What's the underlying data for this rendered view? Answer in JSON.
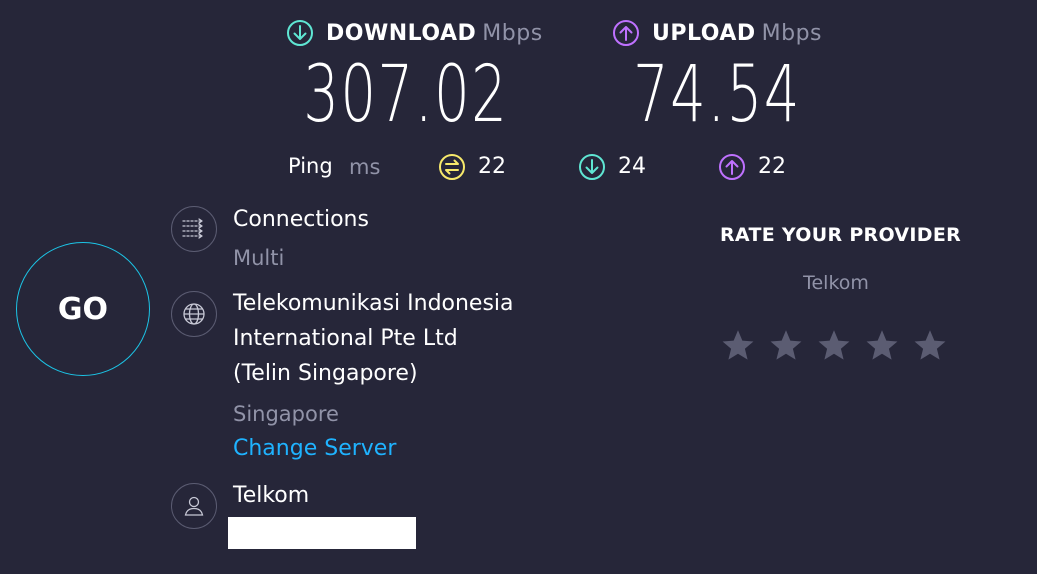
{
  "results": {
    "download": {
      "label": "DOWNLOAD",
      "unit": "Mbps",
      "value": "307.02",
      "icon": "download-arrow-icon",
      "color": "#5fe6d3"
    },
    "upload": {
      "label": "UPLOAD",
      "unit": "Mbps",
      "value": "74.54",
      "icon": "upload-arrow-icon",
      "color": "#bf71ff"
    }
  },
  "ping": {
    "label": "Ping",
    "unit": "ms",
    "idle": {
      "value": "22",
      "icon": "jitter-icon",
      "color": "#f7e96b"
    },
    "download": {
      "value": "24",
      "icon": "download-arrow-icon",
      "color": "#5fe6d3"
    },
    "upload": {
      "value": "22",
      "icon": "upload-arrow-icon",
      "color": "#bf71ff"
    }
  },
  "connections": {
    "title": "Connections",
    "value": "Multi",
    "icon": "connections-icon"
  },
  "server": {
    "name_line1": "Telekomunikasi Indonesia",
    "name_line2": "International Pte Ltd",
    "name_line3": "(Telin Singapore)",
    "location": "Singapore",
    "change_label": "Change Server",
    "icon": "globe-icon"
  },
  "provider": {
    "name": "Telkom",
    "icon": "user-icon"
  },
  "go_label": "GO",
  "rate": {
    "title": "RATE YOUR PROVIDER",
    "provider": "Telkom",
    "stars": 5,
    "star_color": "#5b5c72"
  },
  "colors": {
    "background": "#262639",
    "muted_text": "#9193a8",
    "link": "#1fb3ff",
    "go_ring": "#1cc4e6"
  }
}
